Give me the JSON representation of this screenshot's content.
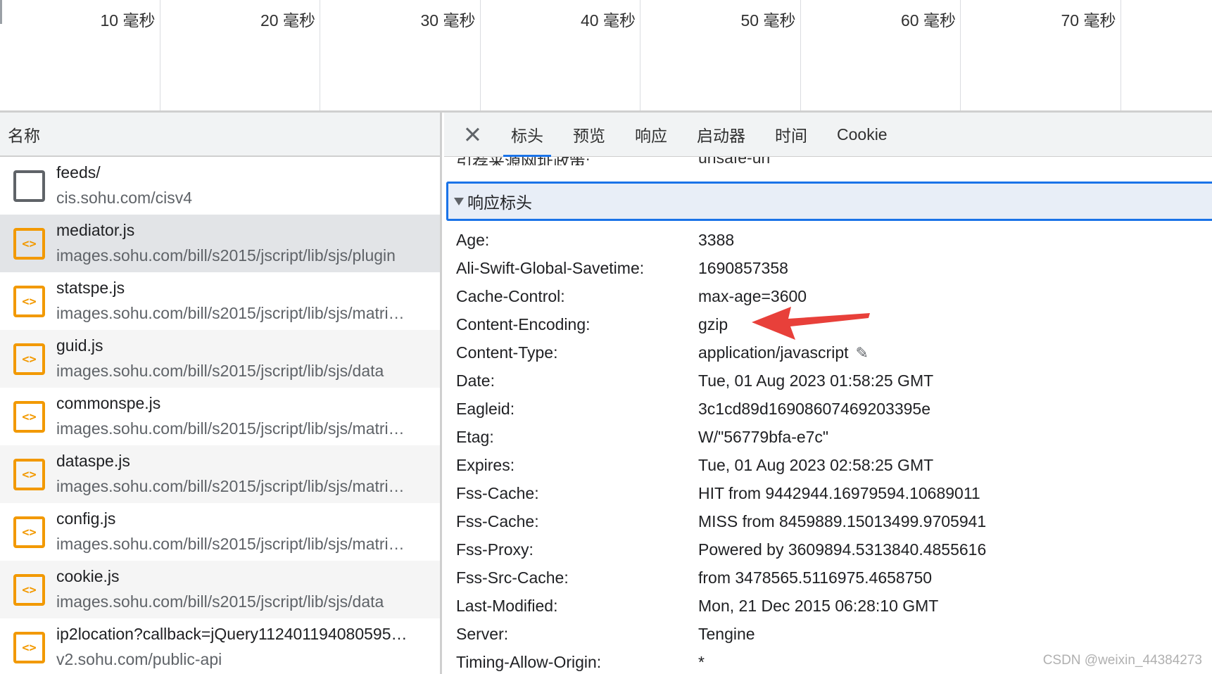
{
  "timeline": {
    "ticks": [
      "10 毫秒",
      "20 毫秒",
      "30 毫秒",
      "40 毫秒",
      "50 毫秒",
      "60 毫秒",
      "70 毫秒"
    ]
  },
  "request_list": {
    "header": "名称",
    "rows": [
      {
        "name": "feeds/",
        "path": "cis.sohu.com/cisv4",
        "type": "document"
      },
      {
        "name": "mediator.js",
        "path": "images.sohu.com/bill/s2015/jscript/lib/sjs/plugin",
        "type": "script",
        "selected": true
      },
      {
        "name": "statspe.js",
        "path": "images.sohu.com/bill/s2015/jscript/lib/sjs/matri…",
        "type": "script"
      },
      {
        "name": "guid.js",
        "path": "images.sohu.com/bill/s2015/jscript/lib/sjs/data",
        "type": "script"
      },
      {
        "name": "commonspe.js",
        "path": "images.sohu.com/bill/s2015/jscript/lib/sjs/matri…",
        "type": "script"
      },
      {
        "name": "dataspe.js",
        "path": "images.sohu.com/bill/s2015/jscript/lib/sjs/matri…",
        "type": "script"
      },
      {
        "name": "config.js",
        "path": "images.sohu.com/bill/s2015/jscript/lib/sjs/matri…",
        "type": "script"
      },
      {
        "name": "cookie.js",
        "path": "images.sohu.com/bill/s2015/jscript/lib/sjs/data",
        "type": "script"
      },
      {
        "name": "ip2location?callback=jQuery112401194080595…",
        "path": "v2.sohu.com/public-api",
        "type": "script"
      }
    ]
  },
  "details": {
    "tabs": [
      "标头",
      "预览",
      "响应",
      "启动器",
      "时间",
      "Cookie"
    ],
    "active_tab": "标头",
    "cutoff_key": "引荐来源网址政策:",
    "cutoff_value": "unsafe-url",
    "section_title": "响应标头",
    "headers": [
      {
        "key": "Age:",
        "value": "3388"
      },
      {
        "key": "Ali-Swift-Global-Savetime:",
        "value": "1690857358"
      },
      {
        "key": "Cache-Control:",
        "value": "max-age=3600"
      },
      {
        "key": "Content-Encoding:",
        "value": "gzip"
      },
      {
        "key": "Content-Type:",
        "value": "application/javascript"
      },
      {
        "key": "Date:",
        "value": "Tue, 01 Aug 2023 01:58:25 GMT"
      },
      {
        "key": "Eagleid:",
        "value": "3c1cd89d16908607469203395e"
      },
      {
        "key": "Etag:",
        "value": "W/\"56779bfa-e7c\""
      },
      {
        "key": "Expires:",
        "value": "Tue, 01 Aug 2023 02:58:25 GMT"
      },
      {
        "key": "Fss-Cache:",
        "value": "HIT from 9442944.16979594.10689011"
      },
      {
        "key": "Fss-Cache:",
        "value": "MISS from 8459889.15013499.9705941"
      },
      {
        "key": "Fss-Proxy:",
        "value": "Powered by 3609894.5313840.4855616"
      },
      {
        "key": "Fss-Src-Cache:",
        "value": "from 3478565.5116975.4658750"
      },
      {
        "key": "Last-Modified:",
        "value": "Mon, 21 Dec 2015 06:28:10 GMT"
      },
      {
        "key": "Server:",
        "value": "Tengine"
      },
      {
        "key": "Timing-Allow-Origin:",
        "value": "*"
      }
    ]
  },
  "annotation": {
    "arrow_color": "#e8403a"
  },
  "watermark": "CSDN @weixin_44384273"
}
